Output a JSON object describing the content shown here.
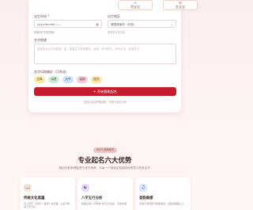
{
  "form": {
    "top_pills": [
      {
        "label": "男宝宝",
        "color": "#c9e0f7"
      },
      {
        "label": "女宝宝",
        "color": "#f5b6c4"
      }
    ],
    "birth_time": {
      "label": "出生时间",
      "required": "*",
      "value": "yyyy/mm/dd --:--",
      "hint": "精确到时辰更准确"
    },
    "birth_place": {
      "label": "出生地区",
      "value": "请选择省份（可选）",
      "hint": "影响五行与方位"
    },
    "expectation": {
      "label": "名字期望",
      "placeholder": "描述您对名字的期望，如：希望名字寓意聪明、健康、有书卷气、好听好记、易读易写..."
    },
    "style": {
      "label": "名字风格偏好（可多选）",
      "chips": [
        {
          "label": "古风",
          "color": "#fde9a8"
        },
        {
          "label": "诗意",
          "color": "#cfeed6"
        },
        {
          "label": "大气",
          "color": "#cfe3f7"
        },
        {
          "label": "温婉",
          "color": "#f9c9d8"
        },
        {
          "label": "阳光",
          "color": "#fde3a8"
        }
      ]
    },
    "submit_label": "开始智能起名",
    "privacy": "您的信息将严格保密，仅用于起名分析"
  },
  "advantages": {
    "badge": "为什么选择我们",
    "title": "专业起名六大优势",
    "subtitle": "融合传统命理智慧与现代审美，为每一个宝宝定制独特而有意义的好名字",
    "cards": [
      {
        "icon": "book-icon",
        "glyph": "📖",
        "icon_bg": "#fde7d6",
        "title": "传统文化底蕴",
        "desc": "深入研究《诗经》《楚辞》等经典，让名字承载千年文化"
      },
      {
        "icon": "bagua-icon",
        "glyph": "☯",
        "icon_bg": "#e9dcf7",
        "title": "八字五行分析",
        "desc": "根据生辰八字精准分析五行喜忌，平衡命理"
      },
      {
        "icon": "music-icon",
        "glyph": "♫",
        "icon_bg": "#dfe8fb",
        "title": "音韵美感",
        "desc": "注重声调搭配与韵律美感，读起来朗朗上口"
      }
    ]
  }
}
